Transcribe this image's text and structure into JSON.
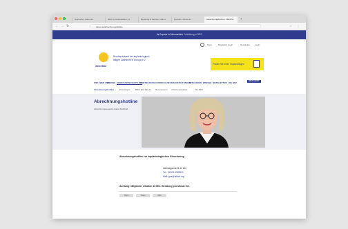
{
  "colors": {
    "brand": "#2f3b8c",
    "accent": "#f4e31a",
    "logo": "#f4c51a"
  },
  "browser": {
    "tabs": [
      {
        "label": "Startseite | ddnet.de"
      },
      {
        "label": "BDZ für Heilpraktiker | Z"
      },
      {
        "label": "Beratung & Service | ddnet"
      },
      {
        "label": "Kontakt | ddnet.de"
      },
      {
        "label": "Abrechnungshotline - BDZ für"
      }
    ],
    "url": "ddnet.de/abrechnungshotline",
    "nav_icons": [
      "back-arrow-icon",
      "forward-arrow-icon",
      "reload-icon"
    ],
    "add_tab_icon": "plus-icon"
  },
  "topstrip": {
    "text": "Ihr Experte in Zahnmedizin",
    "sub": "Fortbildung in BDZ"
  },
  "header": {
    "logo_text": "ddnet BDZ",
    "org_name": "Bundesverband der implantologisch tätigen Zahnärzte in Europa e.V.",
    "util_links": [
      "Shop",
      "Mitglieder Login",
      "Newsletter",
      "Login"
    ],
    "banner_text": "Finden Sie Ihren Implantologen"
  },
  "main_nav": [
    "WIR ÜBER UNS",
    "PRESSE",
    "ABRECHNUNGSHOTLINE",
    "FORTBILDUNG",
    "CURRICULUM",
    "VERANSTALTUNGEN",
    "MITGLIEDER",
    "PRESSE",
    "NEWSLETTER",
    "DIE BDZ",
    "BDZ SHOP"
  ],
  "sub_nav": [
    "Abrechnungshotline",
    "Praxislogos",
    "BDIZ EDI Tabelle",
    "Rezensionen",
    "Arbeits-Gutachter",
    "Ihre BDZ"
  ],
  "hero": {
    "title": "Abrechnungshotline",
    "intro": "Abrechnungsexpertin Isabel Dahlhoff"
  },
  "content": {
    "title": "Abrechnungshotline zur implantologischen Abrechnung",
    "lines": [
      "dienstags von 8-12 Uhr",
      "Tel.: 02203-9989911",
      "Mail: goa@ddnet.org"
    ],
    "note": "Achtung: Mitglieder erhalten 15 Min. Beratung pro Monat frei.",
    "share_buttons": [
      "Teilen",
      "Tweet",
      "Mail"
    ]
  }
}
